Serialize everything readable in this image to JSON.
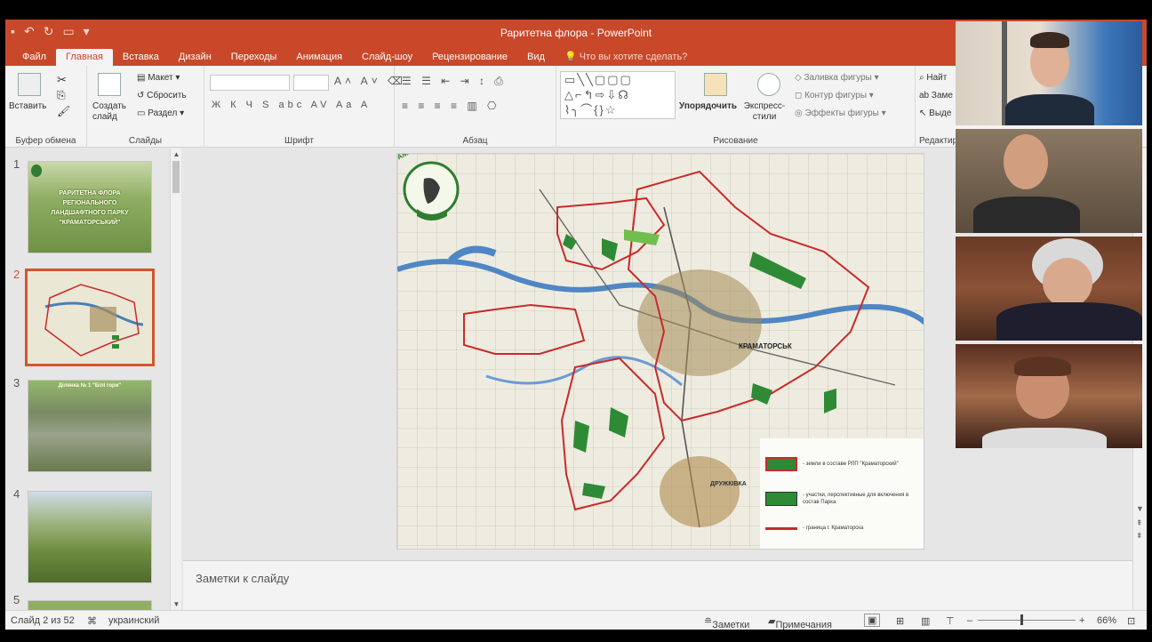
{
  "window": {
    "title": "Раритетна флора - PowerPoint"
  },
  "tabs": [
    {
      "label": "Файл"
    },
    {
      "label": "Главная"
    },
    {
      "label": "Вставка"
    },
    {
      "label": "Дизайн"
    },
    {
      "label": "Переходы"
    },
    {
      "label": "Анимация"
    },
    {
      "label": "Слайд-шоу"
    },
    {
      "label": "Рецензирование"
    },
    {
      "label": "Вид"
    },
    {
      "label": "Что вы хотите сделать?"
    }
  ],
  "ribbon": {
    "clipboard": {
      "paste": "Вставить",
      "label": "Буфер обмена"
    },
    "slides": {
      "create": "Создать слайд",
      "layout": "Макет",
      "reset": "Сбросить",
      "section": "Раздел",
      "label": "Слайды"
    },
    "font": {
      "label": "Шрифт"
    },
    "paragraph": {
      "label": "Абзац"
    },
    "drawing": {
      "arrange": "Упорядочить",
      "styles": "Экспресс-стили",
      "fill": "Заливка фигуры",
      "outline": "Контур фигуры",
      "effects": "Эффекты фигуры",
      "label": "Рисование"
    },
    "editing": {
      "find": "Найт",
      "replace": "Заме",
      "select": "Выде",
      "label": "Редактир"
    }
  },
  "thumbnails": [
    {
      "num": "1",
      "text": "РАРИТЕТНА ФЛОРА РЕГІОНАЛЬНОГО ЛАНДШАФТНОГО ПАРКУ \"КРАМАТОРСЬКИЙ\""
    },
    {
      "num": "2"
    },
    {
      "num": "3",
      "caption": "Ділянка № 1 \"Білі гори\""
    },
    {
      "num": "4"
    },
    {
      "num": "5"
    }
  ],
  "slide": {
    "logo_text": "КРАМАТОРСЬКИЙ",
    "city": "КРАМАТОРСЬК",
    "town2": "ДРУЖКІВКА",
    "legend": [
      {
        "text": "- земли в составе РЛП \"Краматорский\"",
        "color": "#2f8a36"
      },
      {
        "text": "- участки, перспективные для включения в состав Парка",
        "color": "#2f8a36"
      },
      {
        "text": "- граница г. Краматорска",
        "color": "#c92a2a"
      }
    ]
  },
  "notes": {
    "placeholder": "Заметки к слайду"
  },
  "status": {
    "slide": "Слайд 2 из 52",
    "language": "украинский",
    "notes": "Заметки",
    "comments": "Примечания",
    "zoom": "66%"
  }
}
